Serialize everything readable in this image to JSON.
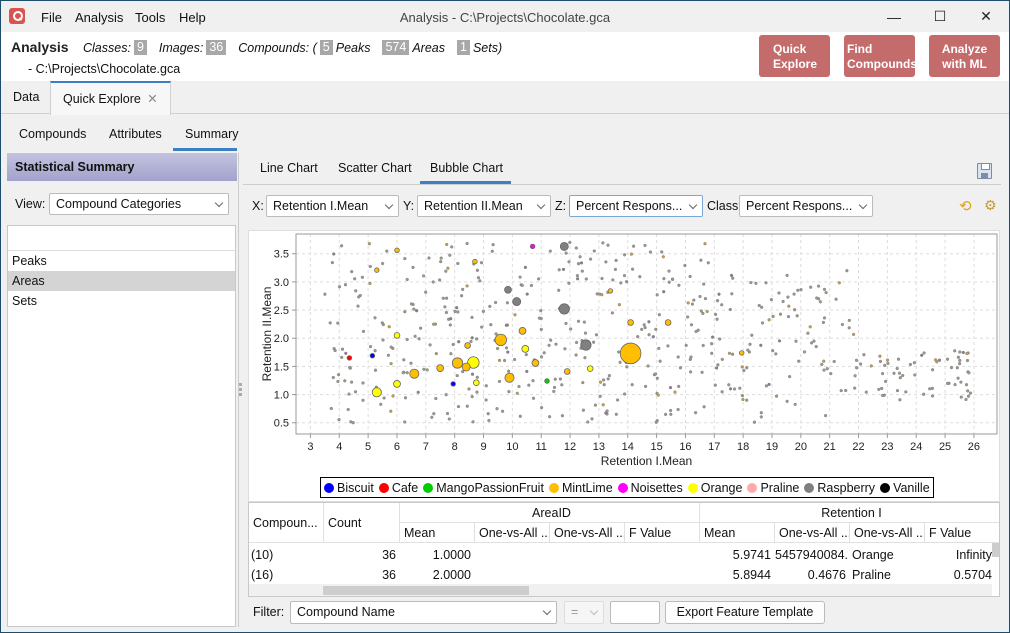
{
  "window": {
    "title": "Analysis - C:\\Projects\\Chocolate.gca",
    "menu": [
      "File",
      "Analysis",
      "Tools",
      "Help"
    ],
    "controls": {
      "minimize": "—",
      "maximize": "☐",
      "close": "✕"
    }
  },
  "header": {
    "title": "Analysis",
    "classes_label": "Classes:",
    "classes_value": "9",
    "images_label": "Images:",
    "images_value": "36",
    "compounds_label": "Compounds: (",
    "peaks_value": "5",
    "peaks_label": "Peaks",
    "areas_value": "574",
    "areas_label": "Areas",
    "sets_value": "1",
    "sets_label": "Sets)",
    "path": "- C:\\Projects\\Chocolate.gca",
    "buttons": [
      {
        "line1": "Quick",
        "line2": "Explore"
      },
      {
        "line1": "Find",
        "line2": "Compounds"
      },
      {
        "line1": "Analyze",
        "line2": "with ML"
      }
    ],
    "button_color": "#c46c6c"
  },
  "main_tabs": [
    {
      "label": "Data",
      "active": false
    },
    {
      "label": "Quick Explore",
      "active": true,
      "close": "✕"
    }
  ],
  "sub_tabs": [
    {
      "label": "Compounds"
    },
    {
      "label": "Attributes"
    },
    {
      "label": "Summary",
      "active": true
    }
  ],
  "left_panel": {
    "title": "Statistical Summary",
    "view_label": "View:",
    "view_value": "Compound Categories",
    "items": [
      {
        "label": "Peaks",
        "selected": false
      },
      {
        "label": "Areas",
        "selected": true
      },
      {
        "label": "Sets",
        "selected": false
      }
    ]
  },
  "chart_tabs": [
    {
      "label": "Line Chart"
    },
    {
      "label": "Scatter Chart"
    },
    {
      "label": "Bubble Chart",
      "active": true
    }
  ],
  "axis_controls": {
    "x_label": "X:",
    "x_value": "Retention I.Mean",
    "y_label": "Y:",
    "y_value": "Retention II.Mean",
    "z_label": "Z:",
    "z_value": "Percent Respons...",
    "class_label": "Class:",
    "class_value": "Percent Respons...",
    "refresh_icon": "⟲",
    "settings_icon": "⚙"
  },
  "chart_data": {
    "type": "scatter",
    "subtype": "bubble",
    "title": "",
    "xlabel": "Retention I.Mean",
    "ylabel": "Retention II.Mean",
    "xlim": [
      2.5,
      26.8
    ],
    "ylim": [
      0.3,
      3.85
    ],
    "xticks": [
      3,
      4,
      5,
      6,
      7,
      8,
      9,
      10,
      11,
      12,
      13,
      14,
      15,
      16,
      17,
      18,
      19,
      20,
      21,
      22,
      23,
      24,
      25,
      26
    ],
    "yticks": [
      0.5,
      1.0,
      1.5,
      2.0,
      2.5,
      3.0,
      3.5
    ],
    "ytick_labels": [
      "0.5",
      "1.0",
      "1.5",
      "2.0",
      "2.5",
      "3.0",
      "3.5"
    ],
    "grid": true,
    "legend_position": "bottom",
    "legend": [
      {
        "name": "Biscuit",
        "color": "#0000ff"
      },
      {
        "name": "Cafe",
        "color": "#ff0000"
      },
      {
        "name": "MangoPassionFruit",
        "color": "#00cc00"
      },
      {
        "name": "MintLime",
        "color": "#ffbf00"
      },
      {
        "name": "Noisettes",
        "color": "#ff00ff"
      },
      {
        "name": "Orange",
        "color": "#ffff00"
      },
      {
        "name": "Praline",
        "color": "#ffaaaa"
      },
      {
        "name": "Raspberry",
        "color": "#808080"
      },
      {
        "name": "Vanille",
        "color": "#000000"
      }
    ],
    "bubbles": [
      {
        "x": 14.1,
        "y": 1.73,
        "size": 9,
        "class": "MintLime"
      },
      {
        "x": 9.6,
        "y": 1.97,
        "size": 5,
        "class": "MintLime"
      },
      {
        "x": 8.65,
        "y": 1.57,
        "size": 5,
        "class": "Orange"
      },
      {
        "x": 8.1,
        "y": 1.56,
        "size": 4.5,
        "class": "MintLime"
      },
      {
        "x": 5.3,
        "y": 1.04,
        "size": 4,
        "class": "Orange"
      },
      {
        "x": 6.6,
        "y": 1.37,
        "size": 4,
        "class": "MintLime"
      },
      {
        "x": 9.9,
        "y": 1.3,
        "size": 4,
        "class": "MintLime"
      },
      {
        "x": 8.4,
        "y": 1.49,
        "size": 3.5,
        "class": "MintLime"
      },
      {
        "x": 11.8,
        "y": 3.63,
        "size": 3.5,
        "class": "Raspberry"
      },
      {
        "x": 11.8,
        "y": 2.52,
        "size": 4.5,
        "class": "Raspberry"
      },
      {
        "x": 12.55,
        "y": 1.88,
        "size": 4.5,
        "class": "Raspberry"
      },
      {
        "x": 10.15,
        "y": 2.65,
        "size": 3.5,
        "class": "Raspberry"
      },
      {
        "x": 9.85,
        "y": 2.86,
        "size": 3,
        "class": "Raspberry"
      },
      {
        "x": 10.35,
        "y": 2.13,
        "size": 3,
        "class": "MintLime"
      },
      {
        "x": 10.45,
        "y": 1.81,
        "size": 3,
        "class": "Orange"
      },
      {
        "x": 10.8,
        "y": 1.56,
        "size": 3,
        "class": "MintLime"
      },
      {
        "x": 7.5,
        "y": 1.47,
        "size": 3,
        "class": "MintLime"
      },
      {
        "x": 6.0,
        "y": 1.19,
        "size": 3,
        "class": "Orange"
      },
      {
        "x": 8.45,
        "y": 1.87,
        "size": 2.5,
        "class": "MintLime"
      },
      {
        "x": 8.75,
        "y": 1.21,
        "size": 2.5,
        "class": "Orange"
      },
      {
        "x": 12.7,
        "y": 1.46,
        "size": 2.5,
        "class": "Orange"
      },
      {
        "x": 15.4,
        "y": 2.28,
        "size": 2.5,
        "class": "MintLime"
      },
      {
        "x": 14.1,
        "y": 2.28,
        "size": 2.5,
        "class": "MintLime"
      },
      {
        "x": 11.2,
        "y": 1.24,
        "size": 2,
        "class": "MangoPassionFruit"
      },
      {
        "x": 7.95,
        "y": 1.19,
        "size": 2,
        "class": "Biscuit"
      },
      {
        "x": 4.35,
        "y": 1.65,
        "size": 2,
        "class": "Cafe"
      },
      {
        "x": 5.15,
        "y": 1.69,
        "size": 2,
        "class": "Biscuit"
      },
      {
        "x": 10.7,
        "y": 3.63,
        "size": 2,
        "class": "Noisettes"
      },
      {
        "x": 6.0,
        "y": 3.56,
        "size": 2,
        "class": "MintLime"
      },
      {
        "x": 8.7,
        "y": 3.36,
        "size": 2,
        "class": "MintLime"
      },
      {
        "x": 5.3,
        "y": 3.21,
        "size": 2,
        "class": "MintLime"
      },
      {
        "x": 6.0,
        "y": 2.05,
        "size": 2.5,
        "class": "Orange"
      },
      {
        "x": 11.9,
        "y": 1.41,
        "size": 2.5,
        "class": "MintLime"
      },
      {
        "x": 13.4,
        "y": 2.84,
        "size": 2,
        "class": "MintLime"
      },
      {
        "x": 17.95,
        "y": 1.74,
        "size": 2,
        "class": "MintLime"
      }
    ],
    "note": "Plus ~500 small grey-brown points (small Percent Response) spread over X 3.5–26 and Y 0.45–3.8"
  },
  "table": {
    "group_headers": [
      "AreaID",
      "Retention I"
    ],
    "columns": [
      "Compoun...",
      "Count",
      "Mean",
      "One-vs-All ...",
      "One-vs-All ...",
      "F Value",
      "Mean",
      "One-vs-All ...",
      "One-vs-All ...",
      "F Value"
    ],
    "rows": [
      [
        "(10)",
        "36",
        "1.0000",
        "",
        "",
        "",
        "5.9741",
        "5457940084...",
        "Orange",
        "Infinity"
      ],
      [
        "(16)",
        "36",
        "2.0000",
        "",
        "",
        "",
        "5.8944",
        "0.4676",
        "Praline",
        "0.5704"
      ]
    ]
  },
  "filter": {
    "label": "Filter:",
    "field_value": "Compound Name",
    "operator_value": "=",
    "value": "",
    "export_label": "Export Feature Template"
  }
}
